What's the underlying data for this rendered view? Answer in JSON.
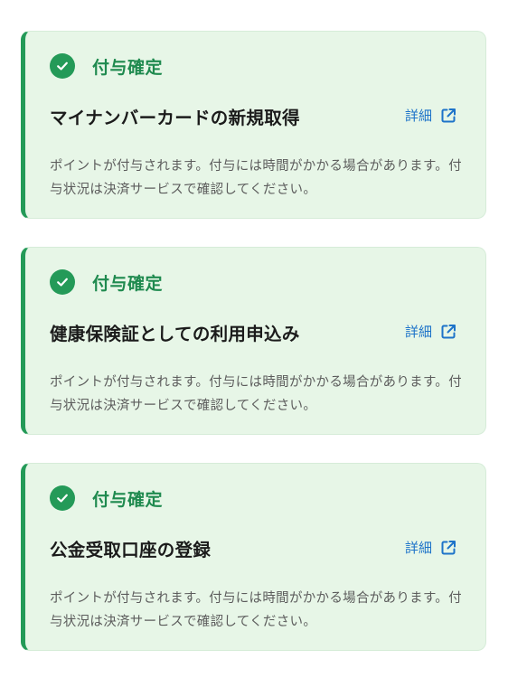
{
  "cards": [
    {
      "status": "付与確定",
      "title": "マイナンバーカードの新規取得",
      "detail_label": "詳細",
      "description": "ポイントが付与されます。付与には時間がかかる場合があります。付与状況は決済サービスで確認してください。"
    },
    {
      "status": "付与確定",
      "title": "健康保険証としての利用申込み",
      "detail_label": "詳細",
      "description": "ポイントが付与されます。付与には時間がかかる場合があります。付与状況は決済サービスで確認してください。"
    },
    {
      "status": "付与確定",
      "title": "公金受取口座の登録",
      "detail_label": "詳細",
      "description": "ポイントが付与されます。付与には時間がかかる場合があります。付与状況は決済サービスで確認してください。"
    }
  ],
  "icons": {
    "status": "check-circle-icon",
    "detail": "external-link-icon"
  },
  "colors": {
    "accent_green": "#249a58",
    "card_background": "#e7f6e7",
    "link_blue": "#1d73c9"
  }
}
